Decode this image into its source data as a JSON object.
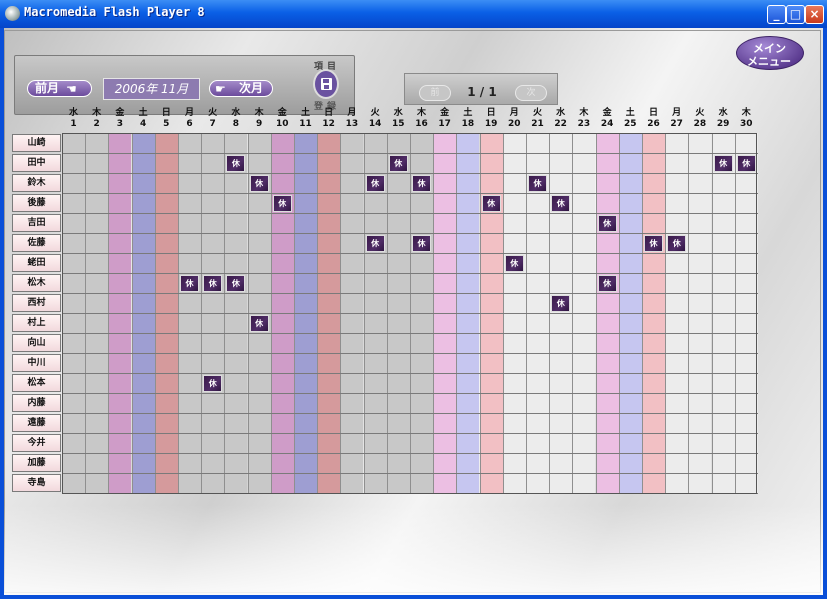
{
  "window": {
    "title": "Macromedia Flash Player 8"
  },
  "window_buttons": {
    "minimize": "_",
    "maximize": "□",
    "close": "×"
  },
  "toolbar": {
    "prev_label": "前月",
    "next_label": "次月",
    "month_label": "2006年 11月",
    "save_top": "項目",
    "save_bottom": "登録",
    "page_prev": "前",
    "page_next": "次",
    "page_indicator": "1 / 1"
  },
  "main_menu": {
    "line1": "メイン",
    "line2": "メニュー"
  },
  "leave_mark": "休",
  "days": [
    {
      "wd": "水",
      "d": "1"
    },
    {
      "wd": "木",
      "d": "2"
    },
    {
      "wd": "金",
      "d": "3"
    },
    {
      "wd": "土",
      "d": "4"
    },
    {
      "wd": "日",
      "d": "5"
    },
    {
      "wd": "月",
      "d": "6"
    },
    {
      "wd": "火",
      "d": "7"
    },
    {
      "wd": "水",
      "d": "8"
    },
    {
      "wd": "木",
      "d": "9"
    },
    {
      "wd": "金",
      "d": "10"
    },
    {
      "wd": "土",
      "d": "11"
    },
    {
      "wd": "日",
      "d": "12"
    },
    {
      "wd": "月",
      "d": "13"
    },
    {
      "wd": "火",
      "d": "14"
    },
    {
      "wd": "水",
      "d": "15"
    },
    {
      "wd": "木",
      "d": "16"
    },
    {
      "wd": "金",
      "d": "17"
    },
    {
      "wd": "土",
      "d": "18"
    },
    {
      "wd": "日",
      "d": "19"
    },
    {
      "wd": "月",
      "d": "20"
    },
    {
      "wd": "火",
      "d": "21"
    },
    {
      "wd": "水",
      "d": "22"
    },
    {
      "wd": "木",
      "d": "23"
    },
    {
      "wd": "金",
      "d": "24"
    },
    {
      "wd": "土",
      "d": "25"
    },
    {
      "wd": "日",
      "d": "26"
    },
    {
      "wd": "月",
      "d": "27"
    },
    {
      "wd": "火",
      "d": "28"
    },
    {
      "wd": "水",
      "d": "29"
    },
    {
      "wd": "木",
      "d": "30"
    }
  ],
  "colors": {
    "fri": "#cf9cc8",
    "sat": "#9e9ed2",
    "sun": "#d59a9c",
    "fri_light": "#ecbfe3",
    "sat_light": "#c6c6f0",
    "sun_light": "#f2c0c4",
    "cell_dark": "#c8c8c8",
    "cell_light": "#ececec"
  },
  "employees": [
    {
      "name": "山崎",
      "leave": []
    },
    {
      "name": "田中",
      "leave": [
        8,
        15,
        29,
        30
      ]
    },
    {
      "name": "鈴木",
      "leave": [
        9,
        14,
        16,
        21
      ]
    },
    {
      "name": "後藤",
      "leave": [
        10,
        19,
        22
      ]
    },
    {
      "name": "吉田",
      "leave": [
        24
      ]
    },
    {
      "name": "佐藤",
      "leave": [
        14,
        16,
        26,
        27
      ]
    },
    {
      "name": "蛯田",
      "leave": [
        20
      ]
    },
    {
      "name": "松木",
      "leave": [
        6,
        7,
        8,
        24
      ]
    },
    {
      "name": "西村",
      "leave": [
        22
      ]
    },
    {
      "name": "村上",
      "leave": [
        9
      ]
    },
    {
      "name": "向山",
      "leave": []
    },
    {
      "name": "中川",
      "leave": []
    },
    {
      "name": "松本",
      "leave": [
        7
      ]
    },
    {
      "name": "内藤",
      "leave": []
    },
    {
      "name": "遠藤",
      "leave": []
    },
    {
      "name": "今井",
      "leave": []
    },
    {
      "name": "加藤",
      "leave": []
    },
    {
      "name": "寺島",
      "leave": []
    }
  ]
}
